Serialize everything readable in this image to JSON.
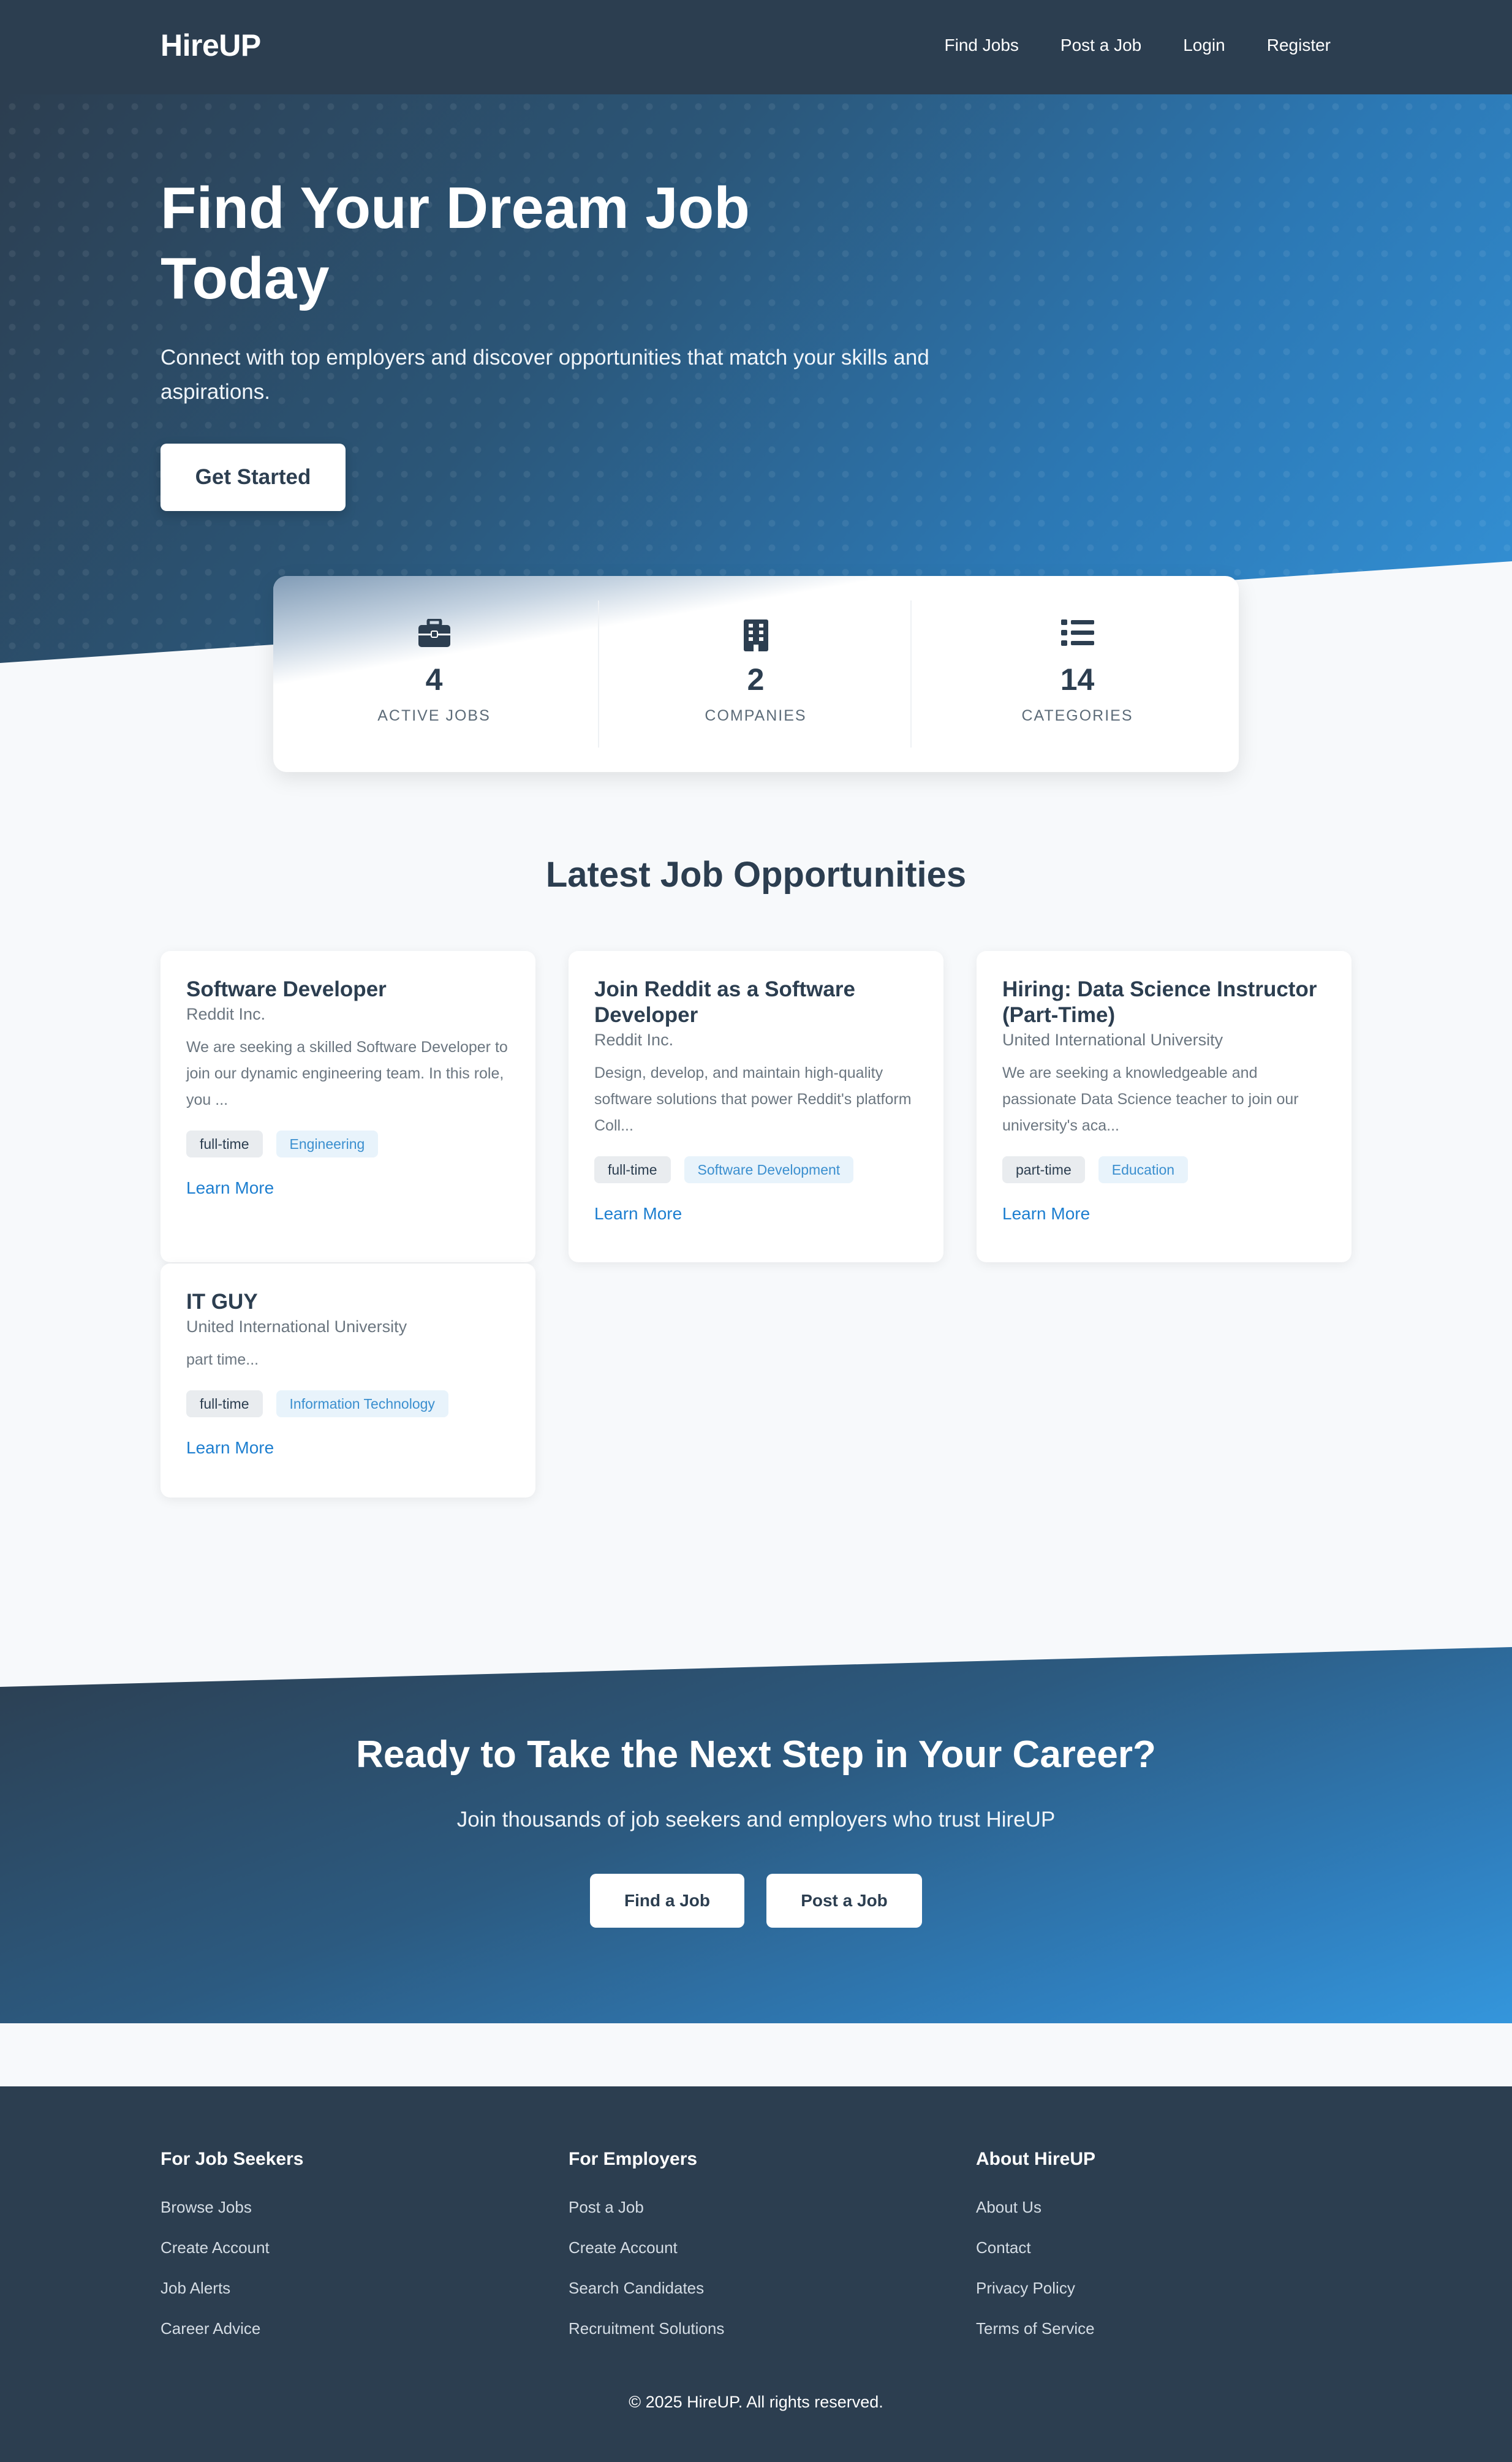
{
  "brand": "HireUP",
  "nav": [
    "Find Jobs",
    "Post a Job",
    "Login",
    "Register"
  ],
  "hero": {
    "title": "Find Your Dream Job Today",
    "subtitle": "Connect with top employers and discover opportunities that match your skills and aspirations.",
    "cta": "Get Started"
  },
  "stats": [
    {
      "icon": "briefcase-icon",
      "value": "4",
      "label": "ACTIVE JOBS"
    },
    {
      "icon": "building-icon",
      "value": "2",
      "label": "COMPANIES"
    },
    {
      "icon": "list-icon",
      "value": "14",
      "label": "CATEGORIES"
    }
  ],
  "jobs_section": {
    "title": "Latest Job Opportunities",
    "jobs": [
      {
        "title": "Software Developer",
        "company": "Reddit Inc.",
        "description": "We are seeking a skilled Software Developer to join our dynamic engineering team. In this role, you ...",
        "type": "full-time",
        "category": "Engineering",
        "link": "Learn More"
      },
      {
        "title": "Join Reddit as a Software Developer",
        "company": "Reddit Inc.",
        "description": "Design, develop, and maintain high-quality software solutions that power Reddit's platform Coll...",
        "type": "full-time",
        "category": "Software Development",
        "link": "Learn More"
      },
      {
        "title": "Hiring: Data Science Instructor (Part-Time)",
        "company": "United International University",
        "description": "We are seeking a knowledgeable and passionate Data Science teacher to join our university's aca...",
        "type": "part-time",
        "category": "Education",
        "link": "Learn More"
      },
      {
        "title": "IT GUY",
        "company": "United International University",
        "description": "part time...",
        "type": "full-time",
        "category": "Information Technology",
        "link": "Learn More"
      }
    ]
  },
  "cta": {
    "title": "Ready to Take the Next Step in Your Career?",
    "subtitle": "Join thousands of job seekers and employers who trust HireUP",
    "find_label": "Find a Job",
    "post_label": "Post a Job"
  },
  "footer": {
    "columns": [
      {
        "heading": "For Job Seekers",
        "links": [
          "Browse Jobs",
          "Create Account",
          "Job Alerts",
          "Career Advice"
        ]
      },
      {
        "heading": "For Employers",
        "links": [
          "Post a Job",
          "Create Account",
          "Search Candidates",
          "Recruitment Solutions"
        ]
      },
      {
        "heading": "About HireUP",
        "links": [
          "About Us",
          "Contact",
          "Privacy Policy",
          "Terms of Service"
        ]
      }
    ],
    "copyright": "© 2025 HireUP. All rights reserved."
  },
  "colors": {
    "navy": "#2c3e50",
    "accent_blue": "#3498db",
    "link_blue": "#1e7fd0"
  }
}
